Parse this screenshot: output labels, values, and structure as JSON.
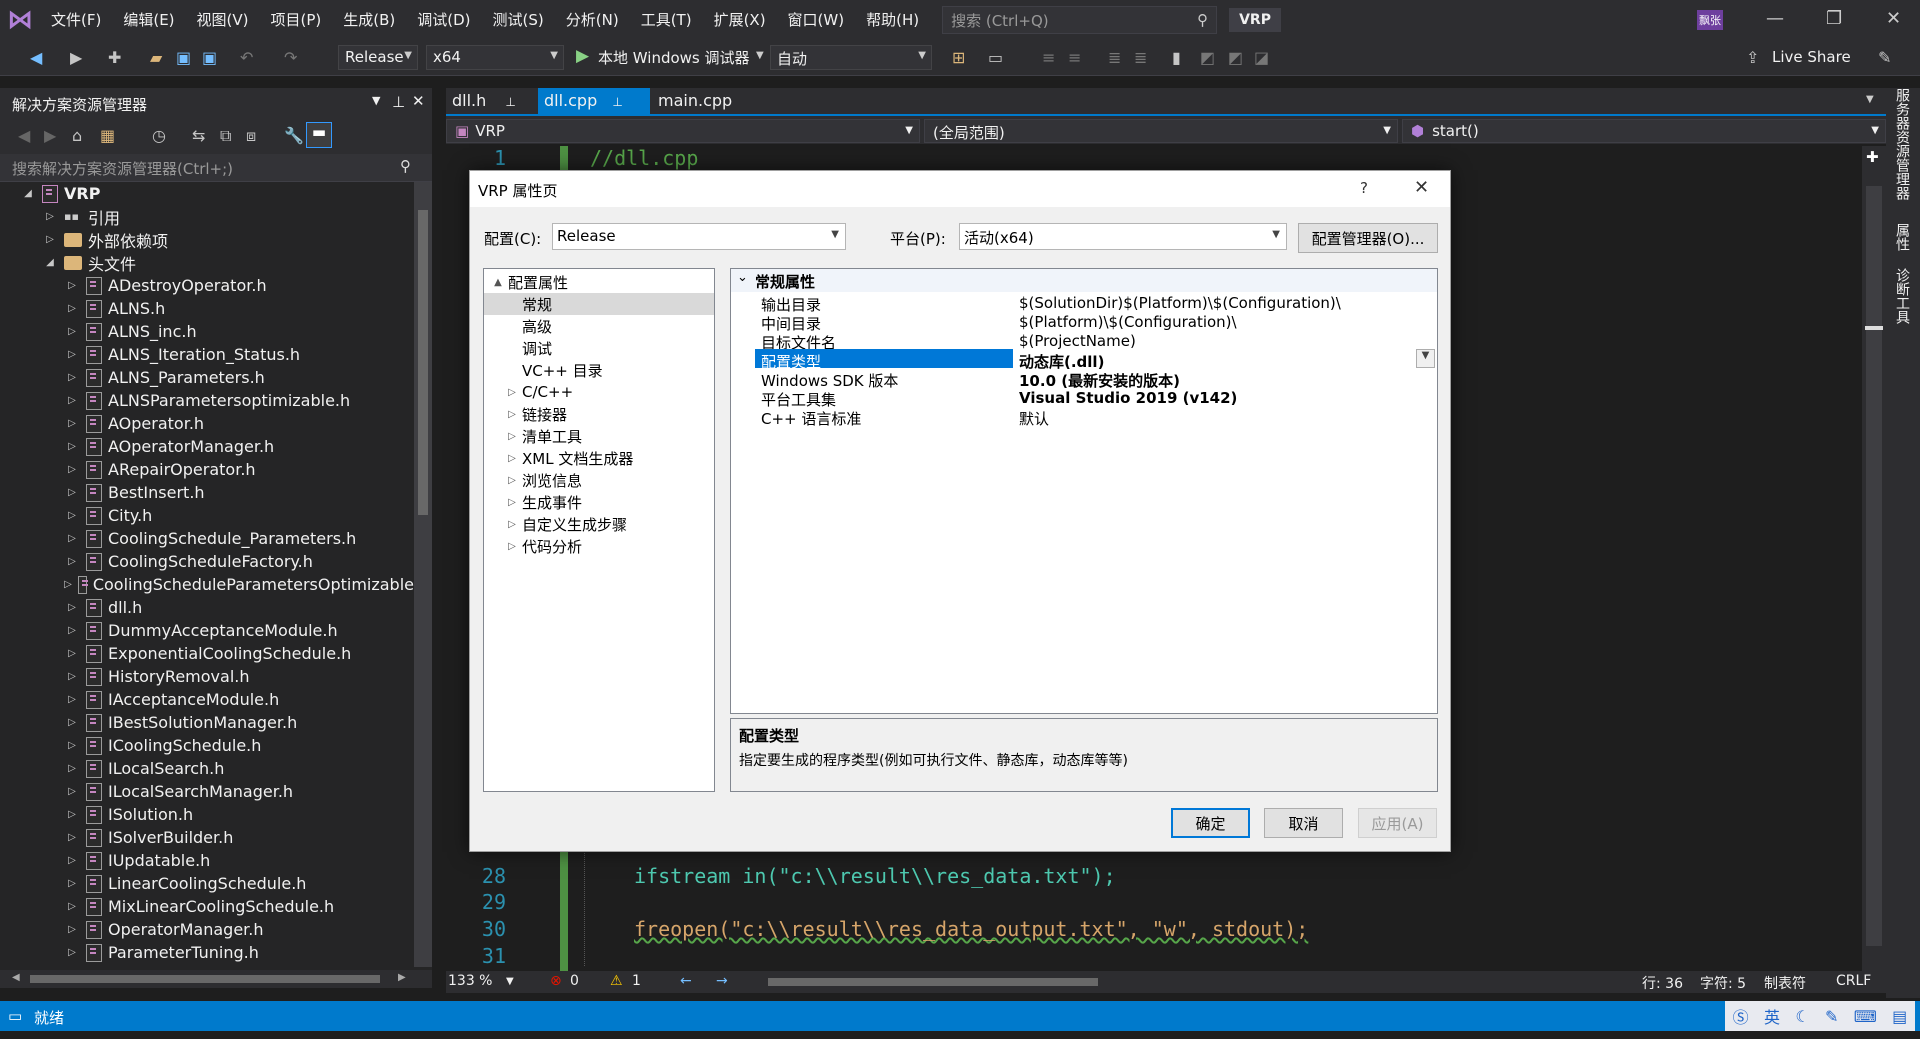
{
  "menubar": {
    "items": [
      "文件(F)",
      "编辑(E)",
      "视图(V)",
      "项目(P)",
      "生成(B)",
      "调试(D)",
      "测试(S)",
      "分析(N)",
      "工具(T)",
      "扩展(X)",
      "窗口(W)",
      "帮助(H)"
    ],
    "search_placeholder": "搜索 (Ctrl+Q)",
    "solution_name": "VRP",
    "user_badge": "飘张",
    "live_share": "Live Share"
  },
  "toolbar": {
    "configuration": "Release",
    "platform": "x64",
    "debugger": "本地 Windows 调试器",
    "debug_mode": "自动"
  },
  "solution_explorer": {
    "title": "解决方案资源管理器",
    "search_placeholder": "搜索解决方案资源管理器(Ctrl+;)",
    "project": "VRP",
    "nodes": [
      {
        "label": "引用",
        "kind": "ref",
        "indent": 1
      },
      {
        "label": "外部依赖项",
        "kind": "folder",
        "indent": 1
      },
      {
        "label": "头文件",
        "kind": "folder",
        "indent": 1,
        "expanded": true
      },
      {
        "label": "ADestroyOperator.h",
        "kind": "file",
        "indent": 2
      },
      {
        "label": "ALNS.h",
        "kind": "file",
        "indent": 2
      },
      {
        "label": "ALNS_inc.h",
        "kind": "file",
        "indent": 2
      },
      {
        "label": "ALNS_Iteration_Status.h",
        "kind": "file",
        "indent": 2
      },
      {
        "label": "ALNS_Parameters.h",
        "kind": "file",
        "indent": 2
      },
      {
        "label": "ALNSParametersoptimizable.h",
        "kind": "file",
        "indent": 2
      },
      {
        "label": "AOperator.h",
        "kind": "file",
        "indent": 2
      },
      {
        "label": "AOperatorManager.h",
        "kind": "file",
        "indent": 2
      },
      {
        "label": "ARepairOperator.h",
        "kind": "file",
        "indent": 2
      },
      {
        "label": "BestInsert.h",
        "kind": "file",
        "indent": 2
      },
      {
        "label": "City.h",
        "kind": "file",
        "indent": 2
      },
      {
        "label": "CoolingSchedule_Parameters.h",
        "kind": "file",
        "indent": 2
      },
      {
        "label": "CoolingScheduleFactory.h",
        "kind": "file",
        "indent": 2
      },
      {
        "label": "CoolingScheduleParametersOptimizable",
        "kind": "file",
        "indent": 2
      },
      {
        "label": "dll.h",
        "kind": "file",
        "indent": 2
      },
      {
        "label": "DummyAcceptanceModule.h",
        "kind": "file",
        "indent": 2
      },
      {
        "label": "ExponentialCoolingSchedule.h",
        "kind": "file",
        "indent": 2
      },
      {
        "label": "HistoryRemoval.h",
        "kind": "file",
        "indent": 2
      },
      {
        "label": "IAcceptanceModule.h",
        "kind": "file",
        "indent": 2
      },
      {
        "label": "IBestSolutionManager.h",
        "kind": "file",
        "indent": 2
      },
      {
        "label": "ICoolingSchedule.h",
        "kind": "file",
        "indent": 2
      },
      {
        "label": "ILocalSearch.h",
        "kind": "file",
        "indent": 2
      },
      {
        "label": "ILocalSearchManager.h",
        "kind": "file",
        "indent": 2
      },
      {
        "label": "ISolution.h",
        "kind": "file",
        "indent": 2
      },
      {
        "label": "ISolverBuilder.h",
        "kind": "file",
        "indent": 2
      },
      {
        "label": "IUpdatable.h",
        "kind": "file",
        "indent": 2
      },
      {
        "label": "LinearCoolingSchedule.h",
        "kind": "file",
        "indent": 2
      },
      {
        "label": "MixLinearCoolingSchedule.h",
        "kind": "file",
        "indent": 2
      },
      {
        "label": "OperatorManager.h",
        "kind": "file",
        "indent": 2
      },
      {
        "label": "ParameterTuning.h",
        "kind": "file",
        "indent": 2
      }
    ]
  },
  "editor": {
    "tabs": [
      {
        "label": "dll.h",
        "active": false
      },
      {
        "label": "dll.cpp",
        "active": true
      },
      {
        "label": "main.cpp",
        "active": false
      }
    ],
    "nav_project": "VRP",
    "nav_scope": "(全局范围)",
    "nav_member": "start()",
    "lines": [
      {
        "num": "1",
        "text": "//dll.cpp",
        "kind": "comment"
      },
      {
        "num": "28",
        "text": "ifstream in(\"c:\\\\result\\\\res_data.txt\");",
        "kind": "code"
      },
      {
        "num": "29",
        "text": "",
        "kind": "code"
      },
      {
        "num": "30",
        "text": "freopen(\"c:\\\\result\\\\res_data_output.txt\", \"w\", stdout);",
        "kind": "code"
      },
      {
        "num": "31",
        "text": "",
        "kind": "code"
      }
    ],
    "zoom": "133 %",
    "errors": "0",
    "warnings": "1",
    "line_col": "行: 36",
    "char": "字符: 5",
    "tabs_mode": "制表符",
    "eol": "CRLF"
  },
  "right_tabs": [
    "服务器资源管理器",
    "属性",
    "诊断工具"
  ],
  "statusbar": {
    "text": "就绪",
    "ime": "英"
  },
  "dialog": {
    "title": "VRP 属性页",
    "help": "?",
    "config_label": "配置(C):",
    "config_value": "Release",
    "platform_label": "平台(P):",
    "platform_value": "活动(x64)",
    "config_manager": "配置管理器(O)...",
    "tree": [
      {
        "label": "配置属性",
        "level": 0,
        "expander": "▲",
        "selected": false
      },
      {
        "label": "常规",
        "level": 1,
        "expander": "",
        "selected": true
      },
      {
        "label": "高级",
        "level": 1,
        "expander": "",
        "selected": false
      },
      {
        "label": "调试",
        "level": 1,
        "expander": "",
        "selected": false
      },
      {
        "label": "VC++ 目录",
        "level": 1,
        "expander": "",
        "selected": false
      },
      {
        "label": "C/C++",
        "level": 1,
        "expander": "▷",
        "selected": false
      },
      {
        "label": "链接器",
        "level": 1,
        "expander": "▷",
        "selected": false
      },
      {
        "label": "清单工具",
        "level": 1,
        "expander": "▷",
        "selected": false
      },
      {
        "label": "XML 文档生成器",
        "level": 1,
        "expander": "▷",
        "selected": false
      },
      {
        "label": "浏览信息",
        "level": 1,
        "expander": "▷",
        "selected": false
      },
      {
        "label": "生成事件",
        "level": 1,
        "expander": "▷",
        "selected": false
      },
      {
        "label": "自定义生成步骤",
        "level": 1,
        "expander": "▷",
        "selected": false
      },
      {
        "label": "代码分析",
        "level": 1,
        "expander": "▷",
        "selected": false
      }
    ],
    "section_title": "常规属性",
    "properties": [
      {
        "name": "输出目录",
        "value": "$(SolutionDir)$(Platform)\\$(Configuration)\\",
        "bold": false,
        "selected": false
      },
      {
        "name": "中间目录",
        "value": "$(Platform)\\$(Configuration)\\",
        "bold": false,
        "selected": false
      },
      {
        "name": "目标文件名",
        "value": "$(ProjectName)",
        "bold": false,
        "selected": false
      },
      {
        "name": "配置类型",
        "value": "动态库(.dll)",
        "bold": true,
        "selected": true
      },
      {
        "name": "Windows SDK 版本",
        "value": "10.0 (最新安装的版本)",
        "bold": true,
        "selected": false
      },
      {
        "name": "平台工具集",
        "value": "Visual Studio 2019 (v142)",
        "bold": true,
        "selected": false
      },
      {
        "name": "C++ 语言标准",
        "value": "默认",
        "bold": false,
        "selected": false
      }
    ],
    "desc_title": "配置类型",
    "desc_text": "指定要生成的程序类型(例如可执行文件、静态库，动态库等等)",
    "ok": "确定",
    "cancel": "取消",
    "apply": "应用(A)"
  }
}
